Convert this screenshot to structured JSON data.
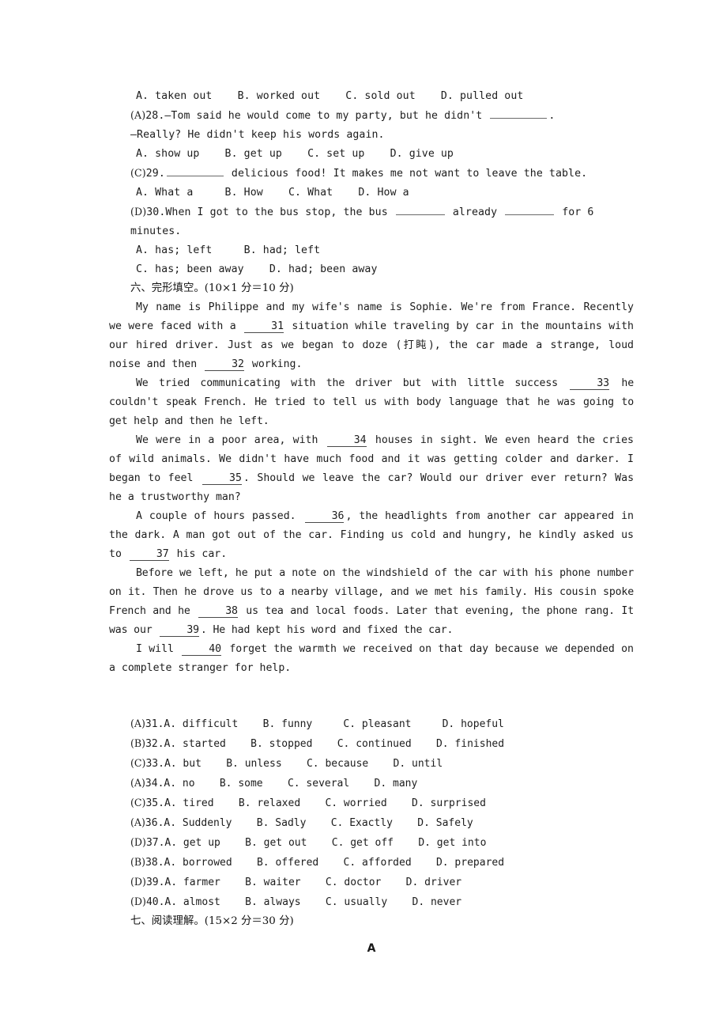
{
  "page": {
    "background": "#ffffff",
    "text_color": "#1c1c1c"
  },
  "multiple_choice_tail": {
    "q27_options": "A. taken out    B. worked out    C. sold out    D. pulled out",
    "questions": [
      {
        "key": "(A)",
        "number": "28.",
        "stem": "—Tom said he would come to my party, but he didn't ",
        "stem_tail": ".",
        "dash_line": "—Really? He didn't keep his words again.",
        "options": "A. show up    B. get up    C. set up    D. give up"
      },
      {
        "key": "(C)",
        "number": "29.",
        "stem_pre": "",
        "stem_post": " delicious food! It makes me not want to leave the table.",
        "options": "A. What a     B. How    C. What    D. How a"
      },
      {
        "key": "(D)",
        "number": "30.",
        "stem_a": "When I got to the bus stop, the bus ",
        "stem_b": " already ",
        "stem_c": " for 6 minutes.",
        "options_line1": "A. has; left     B. had; left",
        "options_line2": "C. has; been away    D. had; been away"
      }
    ]
  },
  "cloze_section": {
    "heading_cjk": "六、完形填空。",
    "heading_score": "(10×1 分＝10 分)",
    "paragraphs": [
      {
        "id": "p1",
        "segments": [
          "My name is Philippe and my wife's name is Sophie. We're from France. Recently we were faced with a ",
          "31",
          " situation while traveling by car in the mountains with our hired driver. Just as we began to doze (打盹), the car made a strange, loud noise and then ",
          "32",
          " working."
        ]
      },
      {
        "id": "p2",
        "segments": [
          "We tried communicating with the driver but with little success ",
          "33",
          " he couldn't speak French. He tried to tell us with body language that he was going to get help and then he left."
        ]
      },
      {
        "id": "p3",
        "segments": [
          "We were in a poor area, with ",
          "34",
          " houses in sight. We even heard the cries of wild animals. We didn't have much food and it was getting colder and darker. I began to feel ",
          "35",
          ". Should we leave the car? Would our driver ever return? Was he a trustworthy man?"
        ]
      },
      {
        "id": "p4",
        "segments": [
          "A couple of hours passed. ",
          "36",
          ",  the headlights from another car appeared in the dark. A man got out of the car. Finding us cold and hungry, he kindly asked us to ",
          "37",
          " his car."
        ]
      },
      {
        "id": "p5",
        "segments": [
          "Before we left, he put a note on the windshield of the car with his phone number on it. Then he drove us to a nearby village, and we met his family. His cousin spoke French and he ",
          "38",
          " us tea and local foods. Later that evening, the phone rang. It was our ",
          "39",
          ". He had kept his word and fixed the car."
        ]
      },
      {
        "id": "p6",
        "segments": [
          "I will ",
          "40",
          " forget the warmth we received on that day because we depended on a complete stranger for help."
        ]
      }
    ],
    "choices": [
      {
        "key": "(A)",
        "number": "31.",
        "text": "A. difficult    B. funny     C. pleasant     D. hopeful"
      },
      {
        "key": "(B)",
        "number": "32.",
        "text": "A. started    B. stopped    C. continued    D. finished"
      },
      {
        "key": "(C)",
        "number": "33.",
        "text": "A. but    B. unless    C. because    D. until"
      },
      {
        "key": "(A)",
        "number": "34.",
        "text": "A. no    B. some    C. several    D. many"
      },
      {
        "key": "(C)",
        "number": "35.",
        "text": "A. tired    B. relaxed    C. worried    D. surprised"
      },
      {
        "key": "(A)",
        "number": "36.",
        "text": "A. Suddenly    B. Sadly    C. Exactly    D. Safely"
      },
      {
        "key": "(D)",
        "number": "37.",
        "text": "A. get up    B. get out    C. get off    D. get into"
      },
      {
        "key": "(B)",
        "number": "38.",
        "text": "A. borrowed    B. offered    C. afforded    D. prepared"
      },
      {
        "key": "(D)",
        "number": "39.",
        "text": "A. farmer    B. waiter    C. doctor    D. driver"
      },
      {
        "key": "(D)",
        "number": "40.",
        "text": "A. almost    B. always    C. usually    D. never"
      }
    ]
  },
  "reading_section": {
    "heading_cjk": "七、阅读理解。",
    "heading_score": "(15×2 分＝30 分)",
    "passage_label": "A"
  }
}
